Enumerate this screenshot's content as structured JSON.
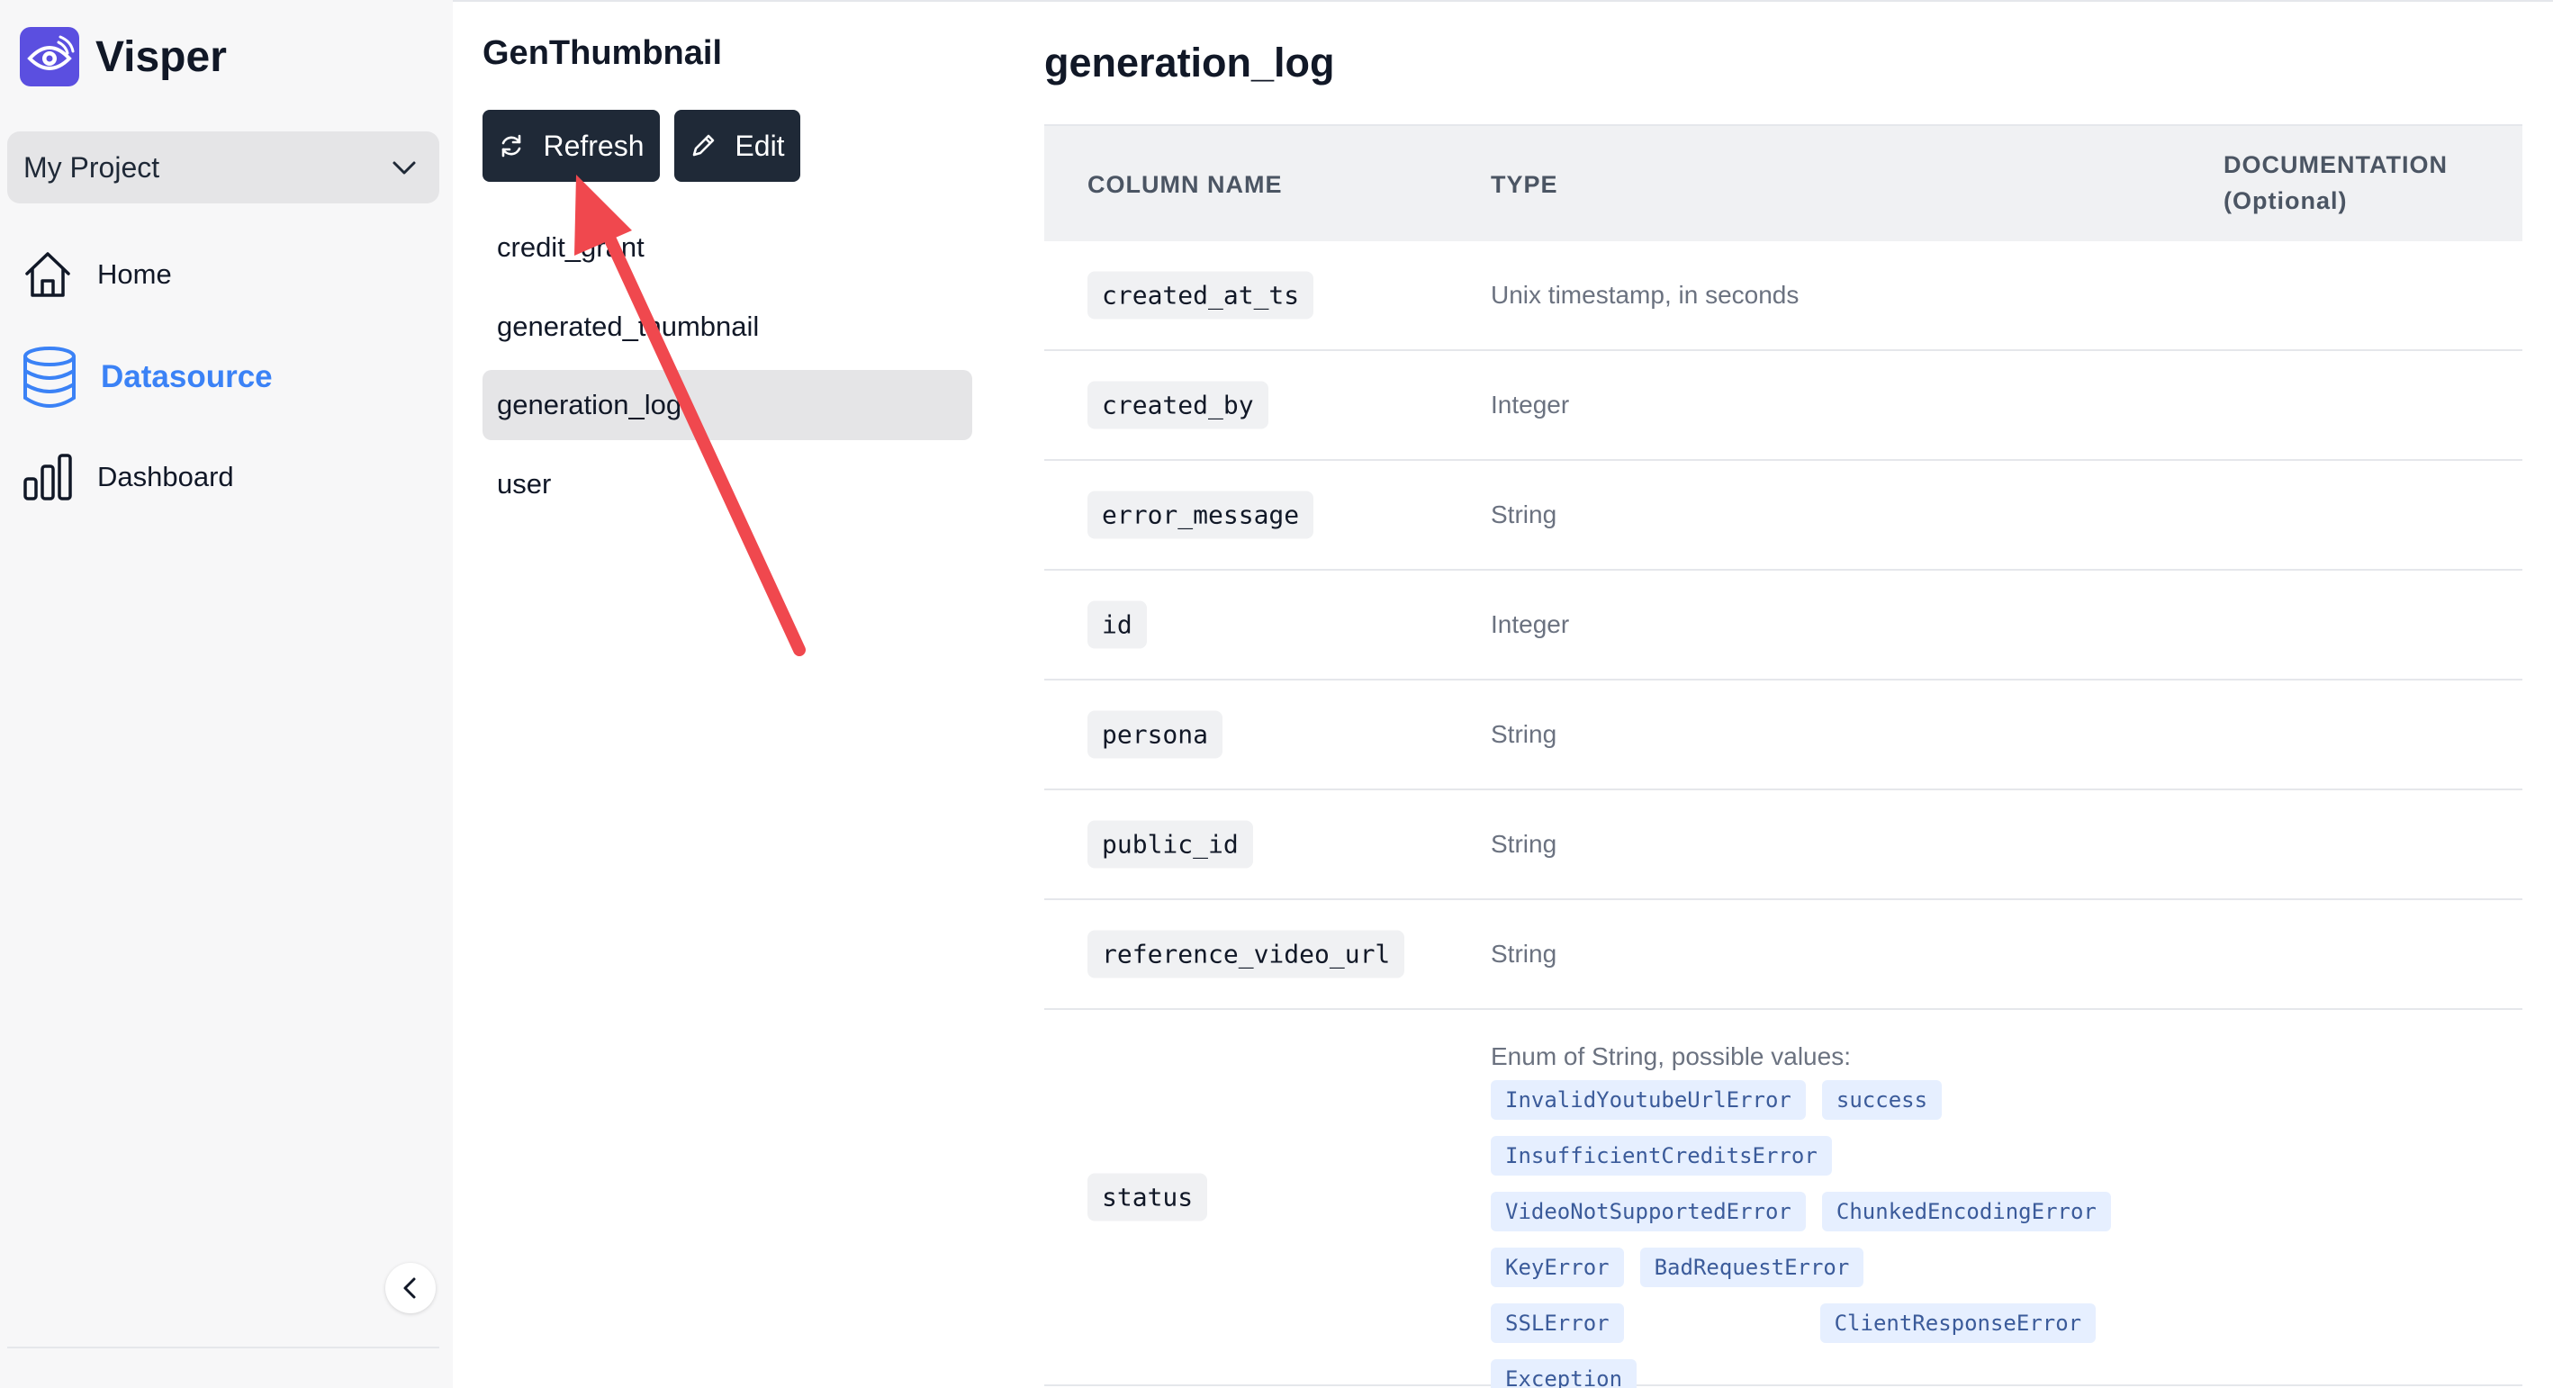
{
  "app": {
    "name": "Visper",
    "logo_icon": "eye-signal-icon",
    "accent": "#5b4fe0"
  },
  "project_select": {
    "value": "My Project"
  },
  "nav": [
    {
      "label": "Home",
      "icon": "home-icon",
      "active": false
    },
    {
      "label": "Datasource",
      "icon": "database-icon",
      "active": true
    },
    {
      "label": "Dashboard",
      "icon": "bar-chart-icon",
      "active": false
    }
  ],
  "datasource": {
    "name": "GenThumbnail",
    "refresh_label": "Refresh",
    "edit_label": "Edit",
    "tables": [
      "credit_grant",
      "generated_thumbnail",
      "generation_log",
      "user"
    ],
    "selected_table": "generation_log"
  },
  "schema": {
    "title": "generation_log",
    "headers": {
      "column": "COLUMN NAME",
      "type": "TYPE",
      "doc_line1": "DOCUMENTATION",
      "doc_line2": "(Optional)"
    },
    "rows": [
      {
        "name": "created_at_ts",
        "type": "Unix timestamp, in seconds"
      },
      {
        "name": "created_by",
        "type": "Integer"
      },
      {
        "name": "error_message",
        "type": "String"
      },
      {
        "name": "id",
        "type": "Integer"
      },
      {
        "name": "persona",
        "type": "String"
      },
      {
        "name": "public_id",
        "type": "String"
      },
      {
        "name": "reference_video_url",
        "type": "String"
      }
    ],
    "enum_row": {
      "name": "status",
      "intro": "Enum of String, possible values:",
      "values": [
        "InvalidYoutubeUrlError",
        "success",
        "InsufficientCreditsError",
        "VideoNotSupportedError",
        "ChunkedEncodingError",
        "KeyError",
        "BadRequestError",
        "SSLError",
        "ClientResponseError",
        "Exception"
      ]
    }
  },
  "annotation": {
    "color": "#f0484e"
  }
}
